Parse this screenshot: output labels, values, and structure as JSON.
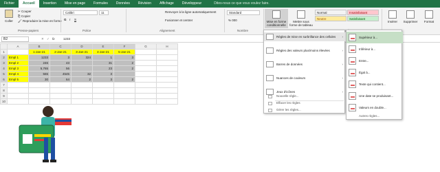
{
  "menubar": {
    "items": [
      "Fichier",
      "Accueil",
      "Insertion",
      "Mise en page",
      "Formules",
      "Données",
      "Révision",
      "Affichage",
      "Développeur"
    ],
    "active": "Accueil",
    "tell_me": "Dites-nous ce que vous voulez faire."
  },
  "ribbon": {
    "clipboard": {
      "paste": "Coller",
      "cut": "Couper",
      "copy": "Copier",
      "format_painter": "Reproduire la mise en forme",
      "label": "Presse-papiers"
    },
    "font": {
      "name": "Calibri",
      "size": "11",
      "label": "Police"
    },
    "alignment": {
      "wrap": "Renvoyer à la ligne automatiquement",
      "merge": "Fusionner et centrer",
      "label": "Alignement"
    },
    "number": {
      "format": "Standard",
      "label": "Nombre"
    },
    "styles": {
      "conditional": "Mise en forme conditionnelle",
      "table": "Mettre sous forme de tableau",
      "cells": [
        {
          "label": "Normal",
          "bg": "#ffffff",
          "fg": "#000000"
        },
        {
          "label": "Insatisfaisant",
          "bg": "#ffc7ce",
          "fg": "#9c0006"
        },
        {
          "label": "Neutre",
          "bg": "#ffeb9c",
          "fg": "#9c5700"
        },
        {
          "label": "Satisfaisant",
          "bg": "#c6efce",
          "fg": "#006100"
        }
      ],
      "label": "Styles"
    },
    "cells_group": {
      "insert": "Insérer",
      "delete": "Supprimer",
      "format": "Format"
    }
  },
  "formula_bar": {
    "name_box": "B2",
    "fx": "fx",
    "value": "1233"
  },
  "sheet": {
    "columns": [
      "A",
      "B",
      "C",
      "D",
      "E",
      "F",
      "G",
      "H"
    ],
    "rows": [
      [
        "",
        "1-Jan-21",
        "2-Jan-21",
        "3-Jan-21",
        "4-Jan-21",
        "5-Jan-21",
        "",
        ""
      ],
      [
        "Empl 1",
        "1233",
        "3",
        "324",
        "1",
        "3",
        "",
        ""
      ],
      [
        "Empl 2",
        "246",
        "43",
        "",
        "31",
        "2",
        "",
        ""
      ],
      [
        "Empl 3",
        "5,765",
        "56",
        "",
        "23",
        "2",
        "",
        ""
      ],
      [
        "Empl 4",
        "565",
        "4545",
        "32",
        "3",
        "",
        "",
        ""
      ],
      [
        "Empl 5",
        "30",
        "64",
        "2",
        "3",
        "2",
        "",
        ""
      ],
      [
        "",
        "",
        "",
        "",
        "",
        "",
        "",
        ""
      ],
      [
        "",
        "",
        "",
        "",
        "",
        "",
        "",
        ""
      ],
      [
        "",
        "",
        "",
        "",
        "",
        "",
        "",
        ""
      ],
      [
        "",
        "",
        "",
        "",
        "",
        "",
        "",
        ""
      ]
    ]
  },
  "cf_menu": {
    "items": [
      {
        "label": "Règles de mise en surbrillance des cellules",
        "highlighted": true
      },
      {
        "label": "Règles des valeurs plus/moins élevées",
        "highlighted": false
      },
      {
        "label": "Barres de données",
        "highlighted": false
      },
      {
        "label": "Nuances de couleurs",
        "highlighted": false
      },
      {
        "label": "Jeux d'icônes",
        "highlighted": false
      }
    ],
    "small": [
      "Nouvelle règle...",
      "Effacer les règles",
      "Gérer les règles..."
    ]
  },
  "submenu": {
    "items": [
      "Supérieur à...",
      "Inférieur à...",
      "Entre...",
      "Égal à...",
      "Texte qui contient...",
      "Une date se produisant...",
      "Valeurs en double..."
    ],
    "more": "Autres règles..."
  }
}
